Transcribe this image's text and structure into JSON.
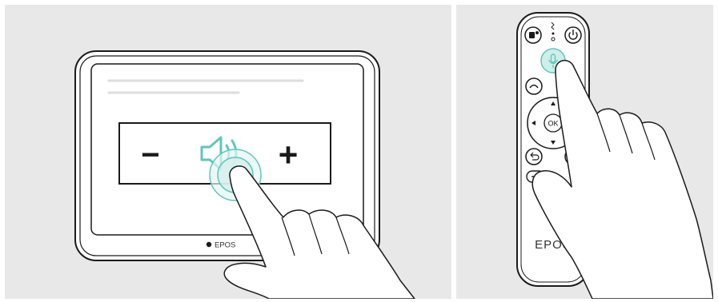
{
  "left_panel": {
    "device": {
      "brand_label": "EPOS",
      "volume_bar": {
        "minus_label": "−",
        "plus_label": "+",
        "icon": "speaker-volume-icon"
      }
    },
    "gesture": "hand-tap-icon"
  },
  "right_panel": {
    "remote": {
      "brand_label": "EPOS",
      "ok_label": "OK",
      "buttons": [
        {
          "icon": "teams-icon"
        },
        {
          "icon": "pairing-led-icon"
        },
        {
          "icon": "power-icon"
        },
        {
          "icon": "microphone-icon"
        },
        {
          "icon": "end-call-icon"
        },
        {
          "icon": "dpad-icon"
        },
        {
          "icon": "back-icon"
        },
        {
          "icon": "cursor-icon"
        },
        {
          "icon": "volume-down-icon"
        }
      ]
    },
    "gesture": "hand-press-icon"
  },
  "colors": {
    "background": "#e8e8e8",
    "outline": "#1a1a1a",
    "accent": "#5fc6bd",
    "accent_fill": "#cfeeea",
    "hand_fill": "#ffffff"
  }
}
